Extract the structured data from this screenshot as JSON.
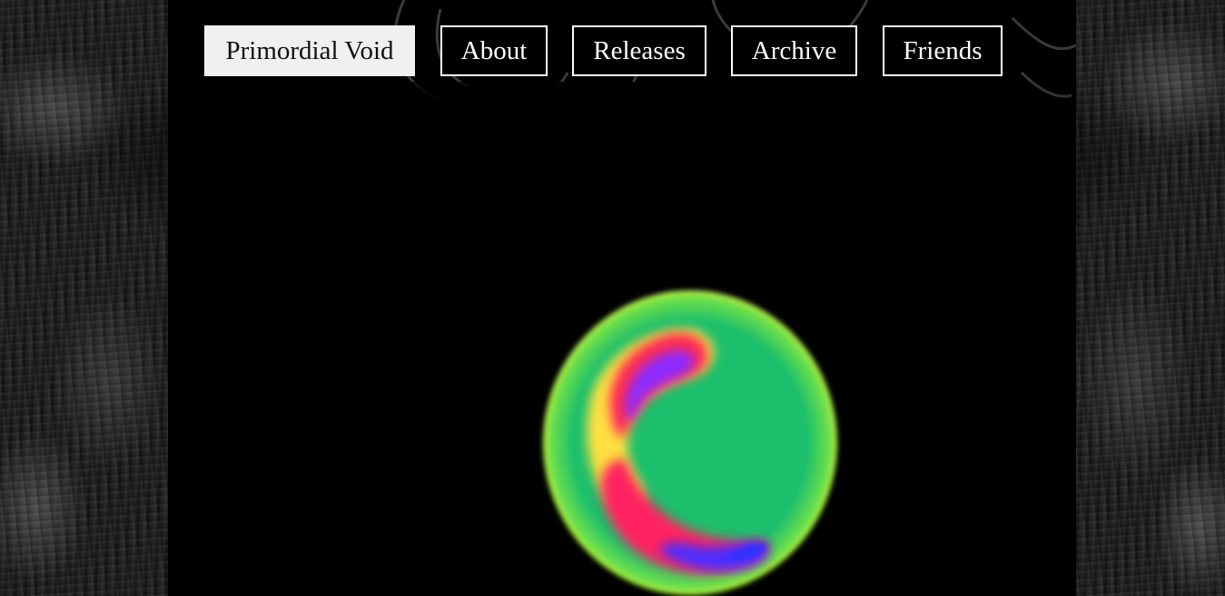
{
  "nav": {
    "brand": "Primordial Void",
    "items": [
      {
        "label": "About"
      },
      {
        "label": "Releases"
      },
      {
        "label": "Archive"
      },
      {
        "label": "Friends"
      }
    ]
  },
  "hero": {
    "image_name": "thermal-orb-image"
  },
  "colors": {
    "nav_border": "#ffffff",
    "nav_bg": "#000000",
    "brand_bg": "#f0f0f0",
    "panel_bg": "#000000",
    "orb_green": "#1db96a",
    "orb_red": "#ff2050",
    "orb_blue": "#3a28ff"
  }
}
